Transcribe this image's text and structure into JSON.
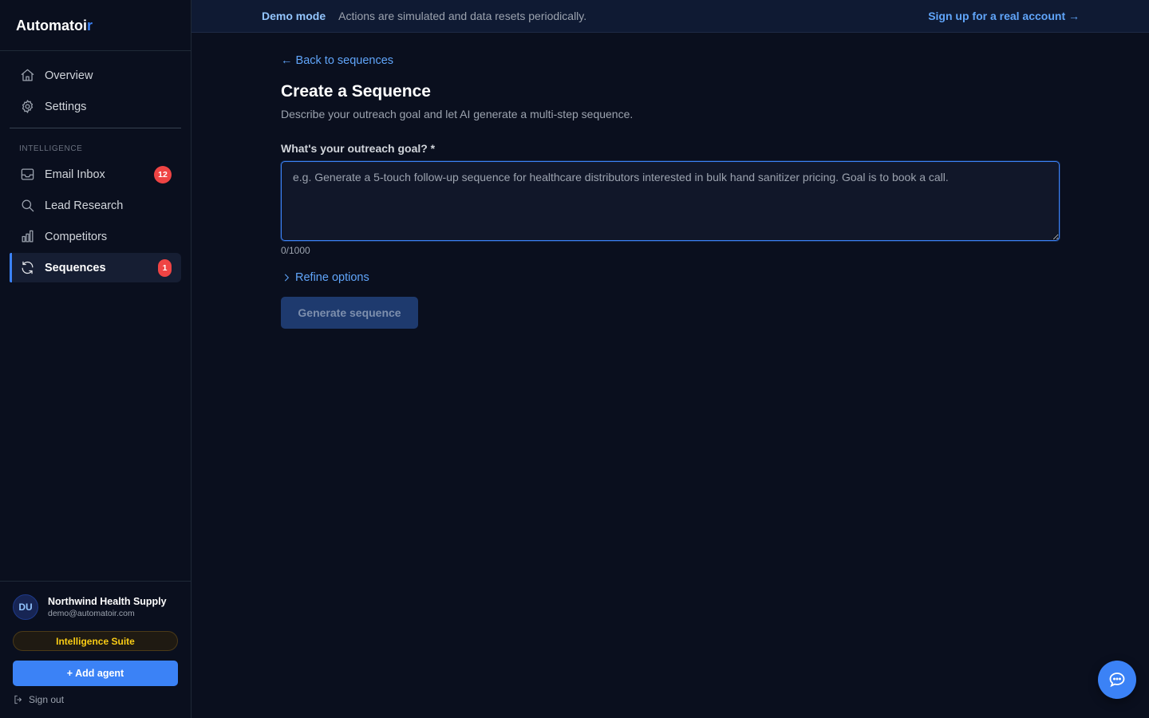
{
  "brand": {
    "name_main": "Automatoi",
    "name_accent": "r"
  },
  "banner": {
    "mode": "Demo mode",
    "message": "Actions are simulated and data resets periodically.",
    "signup": "Sign up for a real account →"
  },
  "sidebar": {
    "top_items": [
      {
        "label": "Overview",
        "icon": "home-icon"
      },
      {
        "label": "Settings",
        "icon": "gear-icon"
      }
    ],
    "section_label": "INTELLIGENCE",
    "items": [
      {
        "label": "Email Inbox",
        "icon": "inbox-icon",
        "badge": "12"
      },
      {
        "label": "Lead Research",
        "icon": "search-icon"
      },
      {
        "label": "Competitors",
        "icon": "bar-chart-icon"
      },
      {
        "label": "Sequences",
        "icon": "refresh-icon",
        "badge": "1",
        "active": true
      }
    ],
    "footer": {
      "avatar_initials": "DU",
      "org_name": "Northwind Health Supply",
      "email": "demo@automatoir.com",
      "plan": "Intelligence Suite",
      "add_agent": "+ Add agent",
      "sign_out": "Sign out"
    }
  },
  "main": {
    "back_link": "← Back to sequences",
    "title": "Create a Sequence",
    "subtitle": "Describe your outreach goal and let AI generate a multi-step sequence.",
    "goal_label": "What's your outreach goal? *",
    "goal_placeholder": "e.g. Generate a 5-touch follow-up sequence for healthcare distributors interested in bulk hand sanitizer pricing. Goal is to book a call.",
    "goal_value": "",
    "char_count": "0/1000",
    "refine_label": "Refine options",
    "generate_label": "Generate sequence"
  },
  "colors": {
    "accent": "#3b82f6",
    "badge": "#ef4444",
    "plan": "#facc15",
    "background": "#0a0f1e"
  }
}
